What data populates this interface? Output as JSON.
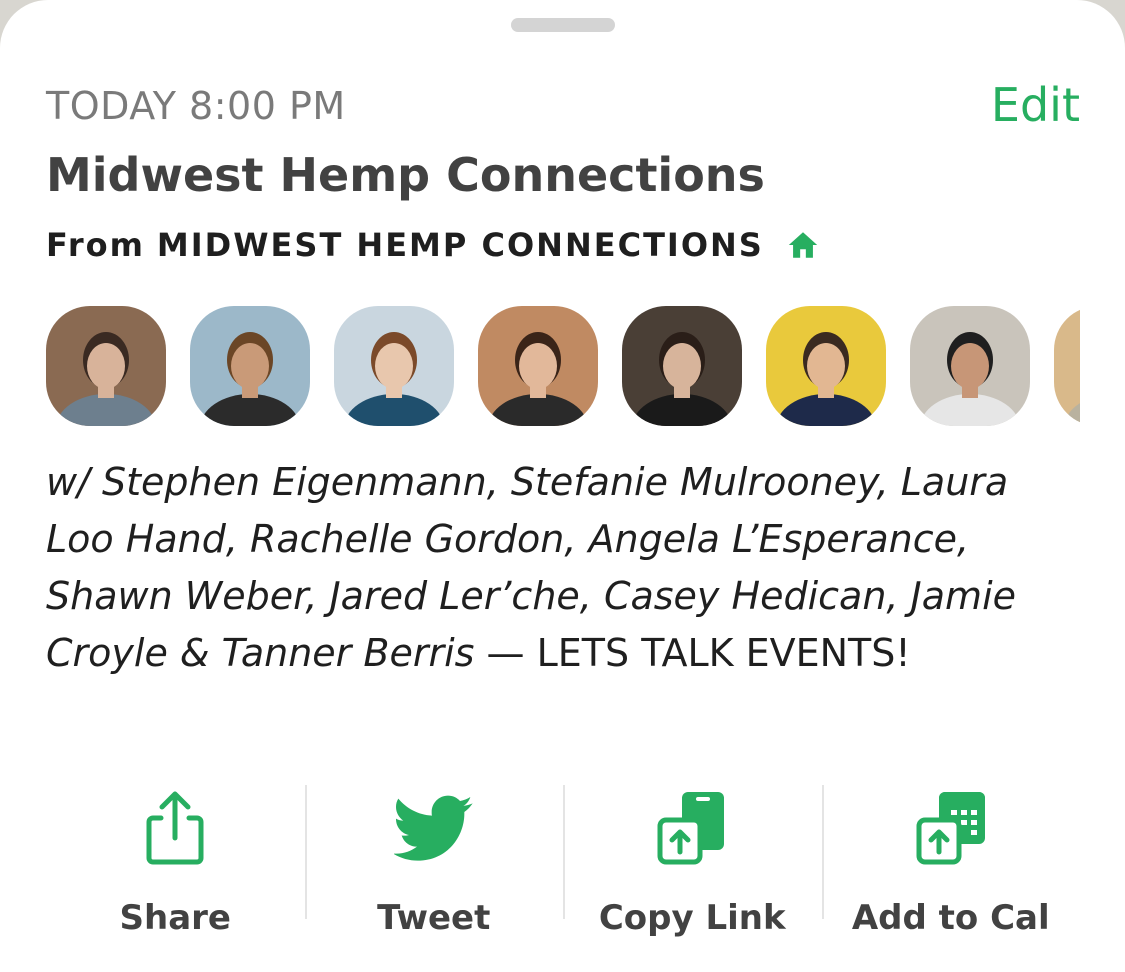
{
  "event": {
    "time": "TODAY 8:00 PM",
    "edit_label": "Edit",
    "title": "Midwest Hemp Connections",
    "from_prefix": "From",
    "club_name": "MIDWEST HEMP CONNECTIONS"
  },
  "speakers": {
    "names_text": "w/ Stephen Eigenmann, Stefanie Mulrooney, Laura Loo Hand, Rachelle Gordon, Angela L’Esperance, Shawn Weber, Jared Ler’che, Casey Hedican, Jamie Croyle & Tanner Berris",
    "topic_text": " — LETS TALK EVENTS!",
    "avatars": [
      {
        "name": "avatar-1",
        "bg": "#8a6a52",
        "skin": "#d8b39a",
        "hair": "#3a2a22",
        "shirt": "#6d7f8e"
      },
      {
        "name": "avatar-2",
        "bg": "#9cb8c9",
        "skin": "#c99a78",
        "hair": "#6b4626",
        "shirt": "#2b2b2b"
      },
      {
        "name": "avatar-3",
        "bg": "#c9d6df",
        "skin": "#e8c7ad",
        "hair": "#7b4a2a",
        "shirt": "#1f4f6d"
      },
      {
        "name": "avatar-4",
        "bg": "#c08a62",
        "skin": "#e2b89a",
        "hair": "#3a2418",
        "shirt": "#2a2a2a"
      },
      {
        "name": "avatar-5",
        "bg": "#4a3f36",
        "skin": "#d7b49b",
        "hair": "#2a1e18",
        "shirt": "#1a1a1a"
      },
      {
        "name": "avatar-6",
        "bg": "#e9c93c",
        "skin": "#e2b792",
        "hair": "#3a2a20",
        "shirt": "#1e2a4a"
      },
      {
        "name": "avatar-7",
        "bg": "#c9c4bb",
        "skin": "#c79677",
        "hair": "#1f1f1f",
        "shirt": "#e6e6e6"
      },
      {
        "name": "avatar-8",
        "bg": "#d9b98a",
        "skin": "#c8967a",
        "hair": "#4a3324",
        "shirt": "#b9b29f"
      }
    ]
  },
  "actions": [
    {
      "label": "Share",
      "icon": "share-icon"
    },
    {
      "label": "Tweet",
      "icon": "twitter-bird-icon"
    },
    {
      "label": "Copy Link",
      "icon": "copy-link-icon"
    },
    {
      "label": "Add to Cal",
      "icon": "add-to-calendar-icon"
    }
  ],
  "colors": {
    "accent": "#27ae60",
    "title": "#424242",
    "subtle": "#7a7a7a"
  }
}
